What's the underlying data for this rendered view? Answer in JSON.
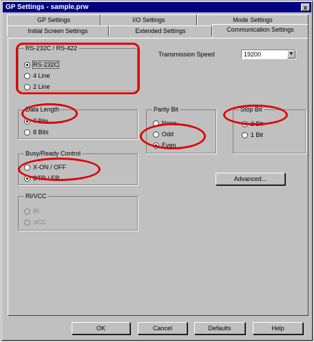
{
  "window": {
    "title": "GP Settings - sample.prw",
    "close_glyph": "x"
  },
  "tabs_row1": [
    "GP Settings",
    "I/O Settings",
    "Mode Settings"
  ],
  "tabs_row2": [
    "Initial Screen Settings",
    "Extended Settings",
    "Communication Settings"
  ],
  "rs_group": {
    "title": "RS-232C / RS-422",
    "options": [
      "RS-232C",
      "4 Line",
      "2 Line"
    ],
    "selected": 0
  },
  "transmission": {
    "label": "Transmission Speed",
    "value": "19200"
  },
  "data_length": {
    "title": "Data Length",
    "options": [
      "7 Bits",
      "8 Bits"
    ],
    "selected": 0
  },
  "parity": {
    "title": "Parity Bit",
    "options": [
      "None",
      "Odd",
      "Even"
    ],
    "selected": 2
  },
  "stop_bit": {
    "title": "Stop Bit",
    "options": [
      "2 Bit",
      "1 Bit"
    ],
    "selected": 0
  },
  "busy": {
    "title": "Busy/Ready Control",
    "options": [
      "X-ON / OFF",
      "DTR / ER"
    ],
    "selected": 1
  },
  "rivcc": {
    "title": "RI/VCC",
    "options": [
      "RI",
      "VCC"
    ]
  },
  "advanced_button": "Advanced...",
  "bottom_buttons": {
    "ok": "OK",
    "cancel": "Cancel",
    "defaults": "Defaults",
    "help": "Help"
  },
  "colors": {
    "highlight": "#e00000",
    "titlebar": "#000080",
    "face": "#c0c0c0"
  }
}
